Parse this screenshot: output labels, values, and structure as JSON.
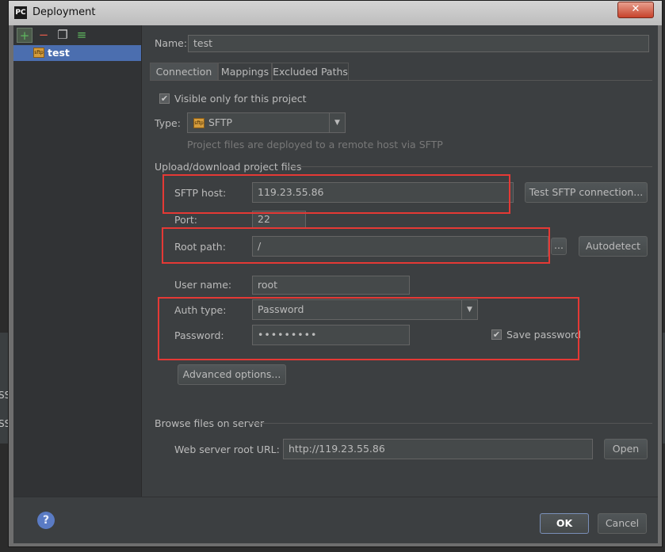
{
  "window": {
    "title": "Deployment",
    "app_icon": "PC",
    "close": "✕"
  },
  "background": {
    "text1": "SS",
    "text2": "SS"
  },
  "sidebar": {
    "toolbar": [
      {
        "icon": "add-icon",
        "glyph": "+"
      },
      {
        "icon": "remove-icon",
        "glyph": "−"
      },
      {
        "icon": "copy-icon",
        "glyph": "❐"
      },
      {
        "icon": "default-server-icon",
        "glyph": "≡"
      }
    ],
    "items": [
      {
        "label": "test",
        "icon_text": "sftp"
      }
    ]
  },
  "form": {
    "name_label": "Name:",
    "name_value": "test",
    "tabs": [
      "Connection",
      "Mappings",
      "Excluded Paths"
    ],
    "visible_only": {
      "label": "Visible only for this project",
      "checked": "✔"
    },
    "type": {
      "label": "Type:",
      "value": "SFTP",
      "icon_text": "sftp",
      "hint": "Project files are deployed to a remote host via SFTP"
    },
    "upload_section": "Upload/download project files",
    "sftp_host": {
      "label": "SFTP host:",
      "value": "119.23.55.86"
    },
    "test_button": "Test SFTP connection...",
    "port": {
      "label": "Port:",
      "value": "22"
    },
    "root_path": {
      "label": "Root path:",
      "value": "/"
    },
    "browse_button": "...",
    "autodetect_button": "Autodetect",
    "user_name": {
      "label": "User name:",
      "value": "root"
    },
    "auth_type": {
      "label": "Auth type:",
      "value": "Password"
    },
    "password": {
      "label": "Password:",
      "value": "•••••••••"
    },
    "save_password": {
      "label": "Save password",
      "checked": "✔"
    },
    "advanced_button": "Advanced options...",
    "browse_section": "Browse files on server",
    "web_url": {
      "label": "Web server root URL:",
      "value": "http://119.23.55.86"
    },
    "open_button": "Open"
  },
  "footer": {
    "help": "?",
    "ok": "OK",
    "cancel": "Cancel"
  },
  "colors": {
    "highlight": "#e53935",
    "selection": "#4b6eaf",
    "panel": "#3c3f41"
  }
}
